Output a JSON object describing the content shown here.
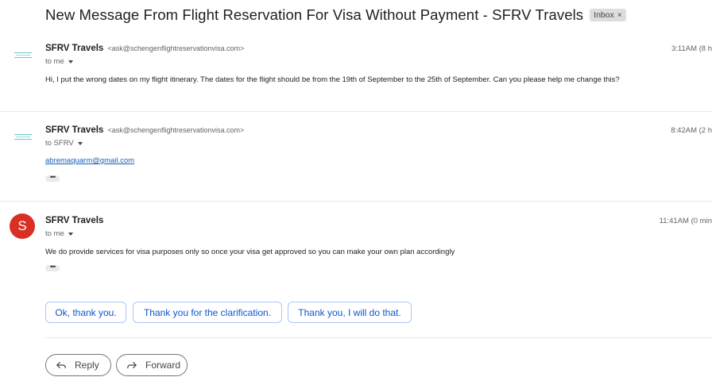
{
  "subject": "New Message From Flight Reservation For Visa Without Payment - SFRV Travels",
  "labels": [
    {
      "name": "Inbox",
      "remove": "×"
    }
  ],
  "messages": [
    {
      "sender": "SFRV Travels",
      "email": "<ask@schengenflightreservationvisa.com>",
      "recipient": "to me",
      "time": "3:11AM (8 h",
      "body": "Hi, I put the wrong dates on my flight itinerary. The dates for the flight should be from the 19th of September to the 25th of September. Can you please help me change this?"
    },
    {
      "sender": "SFRV Travels",
      "email": "<ask@schengenflightreservationvisa.com>",
      "recipient": "to SFRV",
      "time": "8:42AM (2 h",
      "link": "abremaquarm@gmail.com",
      "more": "•••"
    },
    {
      "sender": "SFRV Travels",
      "avatar_letter": "S",
      "avatar_color": "#d93025",
      "recipient": "to me",
      "time": "11:41AM (0 min",
      "body": "We do provide services for visa purposes only so once your visa get approved so you can make your own plan accordingly",
      "more": "•••"
    }
  ],
  "smart_replies": [
    "Ok, thank you.",
    "Thank you for the clarification.",
    "Thank you, I will do that."
  ],
  "actions": {
    "reply": "Reply",
    "forward": "Forward"
  },
  "icons": [
    "reply-arrow-icon",
    "forward-arrow-icon",
    "chevron-down-icon",
    "sender-logo-icon"
  ]
}
